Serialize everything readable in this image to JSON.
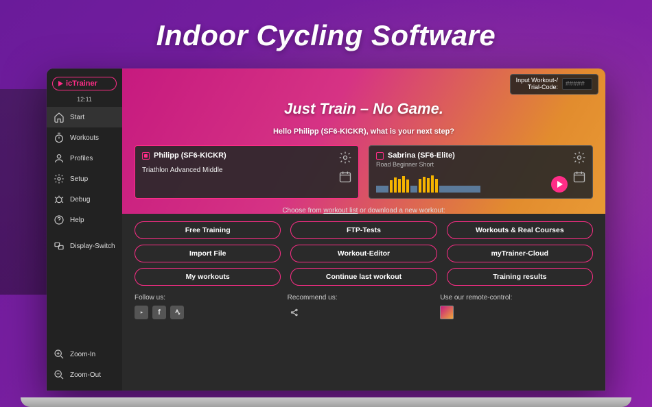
{
  "marketing": {
    "title": "Indoor Cycling Software"
  },
  "app": {
    "logo": "icTrainer",
    "clock": "12:11",
    "nav": {
      "start": "Start",
      "workouts": "Workouts",
      "profiles": "Profiles",
      "setup": "Setup",
      "debug": "Debug",
      "help": "Help",
      "display_switch": "Display-Switch",
      "zoom_in": "Zoom-In",
      "zoom_out": "Zoom-Out"
    },
    "trial": {
      "label_line1": "Input Workout-/",
      "label_line2": "Trial-Code:",
      "placeholder": "#####"
    },
    "hero": {
      "title": "Just Train – No Game.",
      "subtitle": "Hello Philipp (SF6-KICKR), what is your next step?"
    },
    "cards": [
      {
        "name": "Philipp (SF6-KICKR)",
        "subtitle": "",
        "body": "Triathlon Advanced Middle",
        "checked": true
      },
      {
        "name": "Sabrina (SF6-Elite)",
        "subtitle": "Road Beginner Short",
        "body": "",
        "checked": false
      }
    ],
    "choose": {
      "prefix": "Choose from ",
      "link": "workout list",
      "suffix": " or download a new workout:"
    },
    "buttons": [
      "Free Training",
      "FTP-Tests",
      "Workouts & Real Courses",
      "Import File",
      "Workout-Editor",
      "myTrainer-Cloud",
      "My workouts",
      "Continue last workout",
      "Training results"
    ],
    "footer": {
      "follow": "Follow us:",
      "recommend": "Recommend us:",
      "remote": "Use our remote-control:"
    }
  }
}
